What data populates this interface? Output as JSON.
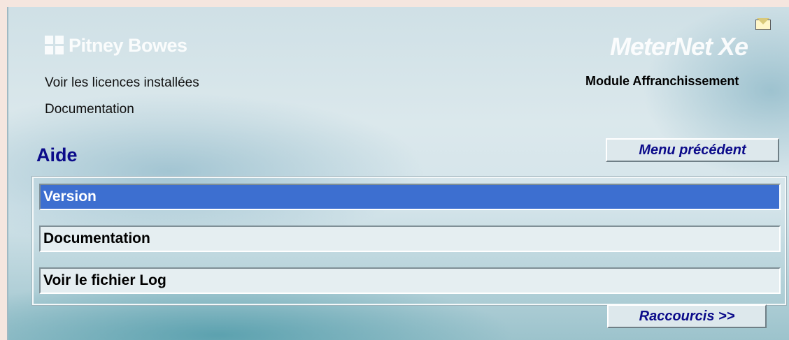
{
  "header": {
    "brand_logo": "Pitney Bowes",
    "product_logo": "MeterNet Xe",
    "module_label": "Module Affranchissement"
  },
  "links": {
    "licenses": "Voir les licences installées",
    "documentation": "Documentation"
  },
  "section": {
    "title": "Aide",
    "back_button": "Menu précédent"
  },
  "menu": {
    "items": [
      {
        "label": "Version",
        "selected": true
      },
      {
        "label": "Documentation",
        "selected": false
      },
      {
        "label": "Voir le fichier Log",
        "selected": false
      }
    ]
  },
  "footer": {
    "shortcuts_button": "Raccourcis >>"
  },
  "icons": {
    "brand": "pitney-bowes-logo-icon",
    "envelope": "envelope-icon"
  },
  "colors": {
    "title": "#0b0b8a",
    "selected_item": "#3d6fd0"
  }
}
